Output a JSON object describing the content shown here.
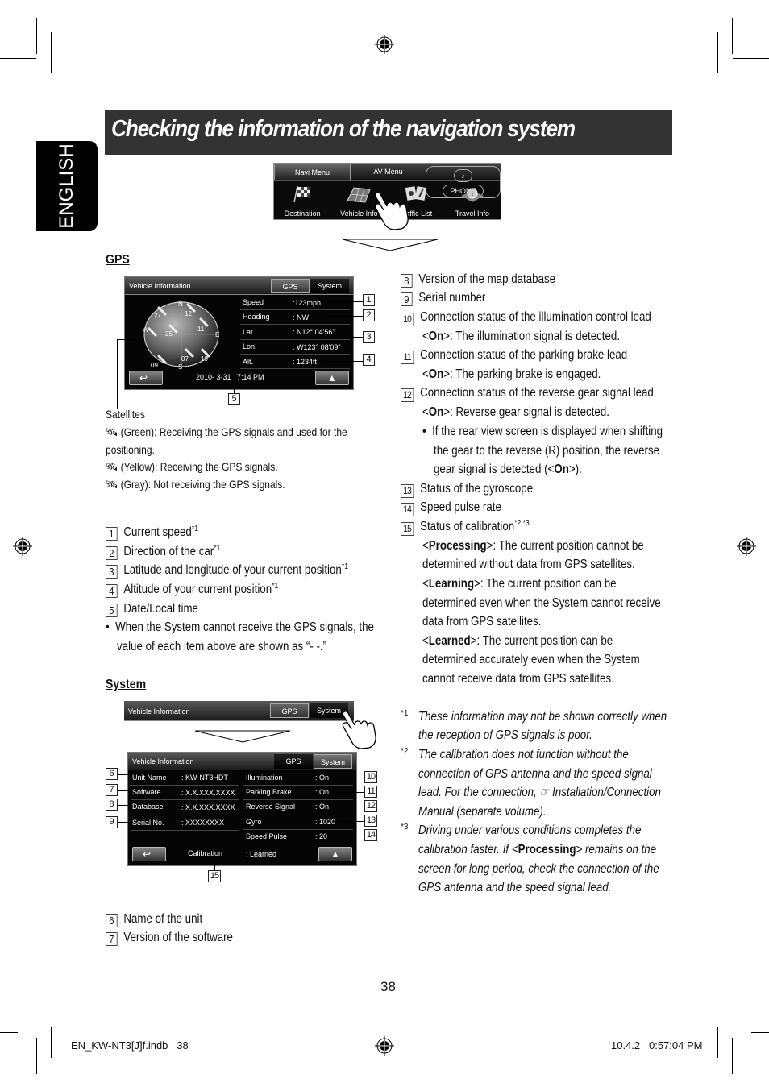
{
  "language_tab": "ENGLISH",
  "title": "Checking the information of the navigation system",
  "menu_screen": {
    "tabs": [
      "Navi Menu",
      "AV Menu",
      "PHONE"
    ],
    "items": [
      {
        "label": "Destination",
        "icon": "checkered-flag-icon"
      },
      {
        "label": "Vehicle Info",
        "icon": "map-grid-icon"
      },
      {
        "label": "Traffic List",
        "icon": "traffic-list-icon"
      },
      {
        "label": "Travel Info",
        "icon": "travel-info-icon"
      }
    ]
  },
  "gps_section": {
    "heading": "GPS",
    "screen": {
      "title": "Vehicle Information",
      "tabs": [
        "GPS",
        "System"
      ],
      "compass": {
        "n": "N",
        "s": "S",
        "e": "E",
        "w": "W"
      },
      "satellites": [
        "27",
        "12",
        "25",
        "11",
        "07",
        "19",
        "09"
      ],
      "rows": [
        {
          "label": "Speed",
          "value": ":123mph",
          "callout": "1"
        },
        {
          "label": "Heading",
          "value": ": NW",
          "callout": "2"
        },
        {
          "label": "Lat.",
          "value": ": N12° 04'56\"",
          "callout": "3"
        },
        {
          "label": "Lon.",
          "value": ": W123° 08'09\"",
          "callout": "3"
        },
        {
          "label": "Alt.",
          "value": ": 1234ft",
          "callout": "4"
        }
      ],
      "datetime": "2010- 3-31   7:14 PM",
      "datetime_callout": "5"
    },
    "satellites_legend": {
      "heading": "Satellites",
      "items": [
        {
          "color": "Green",
          "text": "(Green): Receiving the GPS signals and used for the",
          "cont": "positioning."
        },
        {
          "color": "Yellow",
          "text": "(Yellow): Receiving the GPS signals."
        },
        {
          "color": "Gray",
          "text": "(Gray): Not receiving the GPS signals."
        }
      ]
    },
    "list": [
      {
        "num": "1",
        "text": "Current speed",
        "sup": "*1"
      },
      {
        "num": "2",
        "text": "Direction of the car",
        "sup": "*1"
      },
      {
        "num": "3",
        "text": "Latitude and longitude of your current position",
        "sup": "*1"
      },
      {
        "num": "4",
        "text": "Altitude of your current position",
        "sup": "*1"
      },
      {
        "num": "5",
        "text": "Date/Local time",
        "sup": ""
      }
    ],
    "note_line1": "When the System cannot receive the GPS signals, the",
    "note_line2": "value of each item above are shown as “- -.”"
  },
  "system_section": {
    "heading": "System",
    "header_screen": {
      "title": "Vehicle Information",
      "tabs": [
        "GPS",
        "System"
      ]
    },
    "screen": {
      "title": "Vehicle Information",
      "tabs": [
        "GPS",
        "System"
      ],
      "left_rows": [
        {
          "label": "Unit Name",
          "value": ": KW-NT3HDT",
          "callout": "6"
        },
        {
          "label": "Software",
          "value": ": X.X.XXX.XXXX",
          "callout": "7"
        },
        {
          "label": "Database",
          "value": ": X.X.XXX.XXXX",
          "callout": "8"
        },
        {
          "label": "Serial No.",
          "value": ": XXXXXXXX",
          "callout": "9"
        }
      ],
      "right_rows": [
        {
          "label": "Illumination",
          "value": ": On",
          "callout": "10"
        },
        {
          "label": "Parking Brake",
          "value": ": On",
          "callout": "11"
        },
        {
          "label": "Reverse Signal",
          "value": ": On",
          "callout": "12"
        },
        {
          "label": "Gyro",
          "value": ": 1020",
          "callout": "13"
        },
        {
          "label": "Speed Pulse",
          "value": ": 20",
          "callout": "14"
        }
      ],
      "calibration_label": "Calibration",
      "calibration_value": ": Learned",
      "calibration_callout": "15"
    },
    "list": [
      {
        "num": "6",
        "text": "Name of the unit"
      },
      {
        "num": "7",
        "text": "Version of the software"
      }
    ]
  },
  "right_column": {
    "items": [
      {
        "num": "8",
        "text": "Version of the map database"
      },
      {
        "num": "9",
        "text": "Serial number"
      },
      {
        "num": "10",
        "text": "Connection status of the illumination control lead",
        "sub_bold": "On",
        "sub_text": ": The illumination signal is detected."
      },
      {
        "num": "11",
        "text": "Connection status of the parking brake lead",
        "sub_bold": "On",
        "sub_text": ": The parking brake is engaged."
      },
      {
        "num": "12",
        "text": "Connection status of the reverse gear signal lead",
        "sub_bold": "On",
        "sub_text": ": Reverse gear signal is detected."
      }
    ],
    "bullet_lines": [
      "If the rear view screen is displayed when shifting",
      "the gear to the reverse (R) position, the reverse",
      "gear signal is detected ("
    ],
    "bullet_bold": "On",
    "bullet_end": ").",
    "items2": [
      {
        "num": "13",
        "text": "Status of the gyroscope"
      },
      {
        "num": "14",
        "text": "Speed pulse rate"
      },
      {
        "num": "15",
        "text": "Status of calibration",
        "sup": "*2 *3"
      }
    ],
    "calibration_states": [
      {
        "bold": "Processing",
        "line1": ": The current position cannot be",
        "line2": "determined without data from GPS satellites."
      },
      {
        "bold": "Learning",
        "line1": ": The current position can be",
        "line2": "determined even when the System cannot receive",
        "line3": "data from GPS satellites."
      },
      {
        "bold": "Learned",
        "line1": ": The current position can be",
        "line2": "determined accurately even when the System",
        "line3": "cannot receive data from GPS satellites."
      }
    ],
    "footnotes": [
      {
        "mark": "*1",
        "lines": [
          "These information may not be shown correctly when",
          "the reception of GPS signals is poor."
        ]
      },
      {
        "mark": "*2",
        "lines": [
          "The calibration does not function without the",
          "connection of GPS antenna and the speed signal",
          "lead. For the connection, ☞ Installation/Connection",
          "Manual (separate volume)."
        ]
      },
      {
        "mark": "*3",
        "lines_pre": "Driving under various conditions completes the",
        "line2_a": "calibration faster. If <",
        "line2_bold": "Processing",
        "line2_b": "> remains on the",
        "lines_post": [
          "screen for long period, check the connection of the",
          "GPS antenna and the speed signal lead."
        ]
      }
    ]
  },
  "page_number": "38",
  "slug_left": "EN_KW-NT3[J]f.indb   38",
  "slug_right": "10.4.2   0:57:04 PM"
}
